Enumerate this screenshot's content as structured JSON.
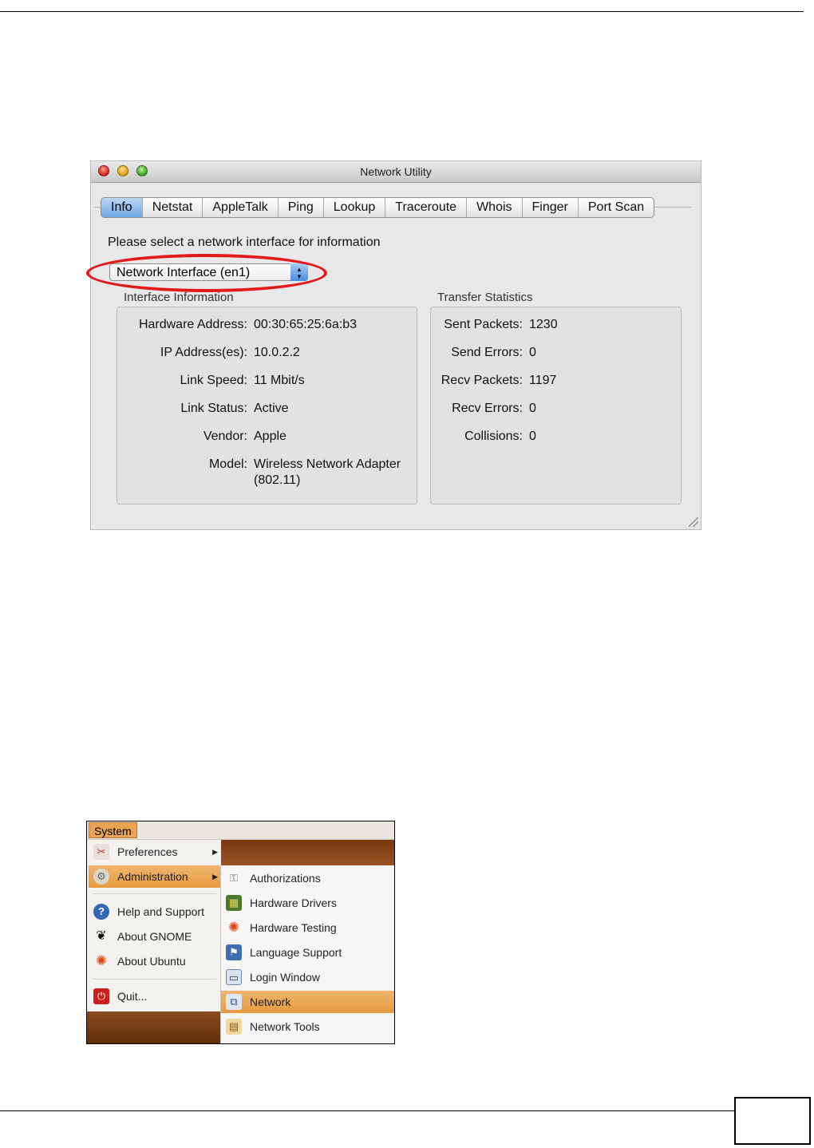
{
  "network_utility": {
    "window_title": "Network Utility",
    "tabs": [
      "Info",
      "Netstat",
      "AppleTalk",
      "Ping",
      "Lookup",
      "Traceroute",
      "Whois",
      "Finger",
      "Port Scan"
    ],
    "active_tab": "Info",
    "prompt": "Please select a network interface for information",
    "interface_select": "Network Interface (en1)",
    "interface_info": {
      "title": "Interface Information",
      "rows": [
        {
          "label": "Hardware Address:",
          "value": "00:30:65:25:6a:b3"
        },
        {
          "label": "IP Address(es):",
          "value": "10.0.2.2"
        },
        {
          "label": "Link Speed:",
          "value": "11 Mbit/s"
        },
        {
          "label": "Link Status:",
          "value": "Active"
        },
        {
          "label": "Vendor:",
          "value": "Apple"
        },
        {
          "label": "Model:",
          "value": "Wireless Network Adapter",
          "value2": "(802.11)"
        }
      ]
    },
    "transfer_stats": {
      "title": "Transfer Statistics",
      "rows": [
        {
          "label": "Sent Packets:",
          "value": "1230"
        },
        {
          "label": "Send Errors:",
          "value": "0"
        },
        {
          "label": "Recv Packets:",
          "value": "1197"
        },
        {
          "label": "Recv Errors:",
          "value": "0"
        },
        {
          "label": "Collisions:",
          "value": "0"
        }
      ]
    }
  },
  "ubuntu_menu": {
    "system_label": "System",
    "main_items": [
      {
        "label": "Preferences",
        "icon": "preferences-icon"
      },
      {
        "label": "Administration",
        "icon": "administration-icon"
      },
      {
        "label": "Help and Support",
        "icon": "help-icon"
      },
      {
        "label": "About GNOME",
        "icon": "gnome-foot-icon"
      },
      {
        "label": "About Ubuntu",
        "icon": "ubuntu-logo-icon"
      },
      {
        "label": "Quit...",
        "icon": "power-icon"
      }
    ],
    "admin_items": [
      {
        "label": "Authorizations",
        "icon": "keys-icon"
      },
      {
        "label": "Hardware Drivers",
        "icon": "hardware-card-icon"
      },
      {
        "label": "Hardware Testing",
        "icon": "ubuntu-logo-icon"
      },
      {
        "label": "Language Support",
        "icon": "flag-icon"
      },
      {
        "label": "Login Window",
        "icon": "login-window-icon"
      },
      {
        "label": "Network",
        "icon": "network-icon"
      },
      {
        "label": "Network Tools",
        "icon": "network-tools-icon"
      }
    ],
    "highlighted": [
      "Administration",
      "Network"
    ]
  }
}
